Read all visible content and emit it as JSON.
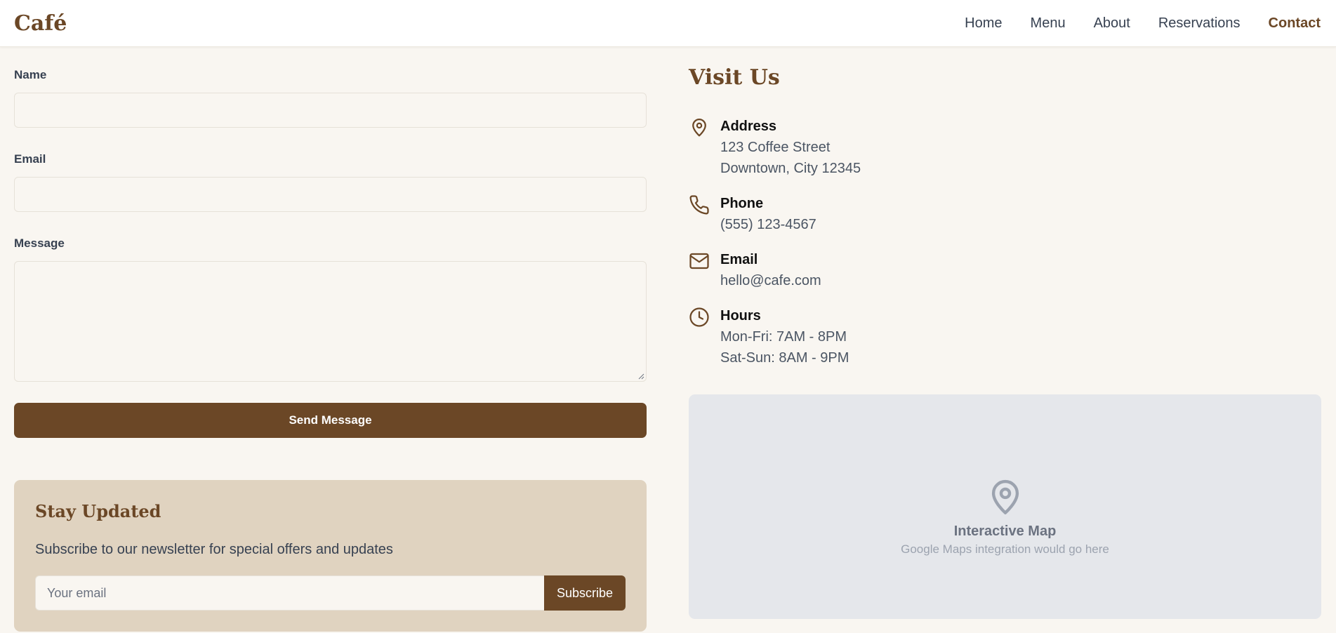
{
  "nav": {
    "brand": "Café",
    "links": [
      "Home",
      "Menu",
      "About",
      "Reservations",
      "Contact"
    ],
    "active": "Contact"
  },
  "form": {
    "name_label": "Name",
    "email_label": "Email",
    "message_label": "Message",
    "name_value": "",
    "email_value": "",
    "message_value": "",
    "submit_label": "Send Message"
  },
  "newsletter": {
    "title": "Stay Updated",
    "text": "Subscribe to our newsletter for special offers and updates",
    "placeholder": "Your email",
    "button_label": "Subscribe"
  },
  "visit": {
    "title": "Visit Us",
    "address": {
      "label": "Address",
      "icon": "location-pin-icon",
      "lines": [
        "123 Coffee Street",
        "Downtown, City 12345"
      ]
    },
    "phone": {
      "label": "Phone",
      "icon": "phone-icon",
      "lines": [
        "(555) 123-4567"
      ]
    },
    "email": {
      "label": "Email",
      "icon": "mail-icon",
      "lines": [
        "hello@cafe.com"
      ]
    },
    "hours": {
      "label": "Hours",
      "icon": "clock-icon",
      "lines": [
        "Mon-Fri: 7AM - 8PM",
        "Sat-Sun: 8AM - 9PM"
      ]
    }
  },
  "map": {
    "icon": "map-pin-icon",
    "title": "Interactive Map",
    "subtitle": "Google Maps integration would go here"
  },
  "colors": {
    "brand_brown": "#6b4726",
    "page_bg": "#f9f6f1",
    "newsletter_bg": "#e0d3c0",
    "map_bg": "#e5e7eb"
  }
}
